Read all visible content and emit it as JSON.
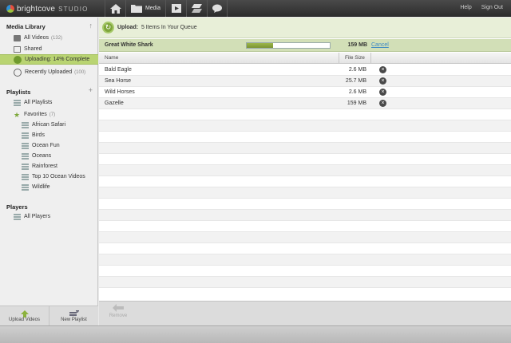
{
  "brand": {
    "name": "brightcove",
    "product": "STUDIO"
  },
  "topnav": {
    "media_label": "Media",
    "help": "Help",
    "sign_out": "Sign Out"
  },
  "sidebar": {
    "media_library": {
      "title": "Media Library",
      "items": [
        {
          "label": "All Videos",
          "count": "(132)"
        },
        {
          "label": "Shared",
          "count": ""
        },
        {
          "label": "Uploading:  14% Complete",
          "count": ""
        },
        {
          "label": "Recently Uploaded",
          "count": "(100)"
        }
      ]
    },
    "playlists": {
      "title": "Playlists",
      "all_label": "All Playlists",
      "favorites": {
        "label": "Favorites",
        "count": "(7)"
      },
      "items": [
        "African Safari",
        "Birds",
        "Ocean Fun",
        "Oceans",
        "Rainforest",
        "Top 10 Ocean Videos",
        "Wildlife"
      ]
    },
    "players": {
      "title": "Players",
      "all_label": "All Players"
    },
    "buttons": {
      "upload": "Upload Videos",
      "new_playlist": "New Playlist"
    }
  },
  "queue": {
    "prefix": "Upload:",
    "text": "5 Items In Your Queue",
    "current": {
      "name": "Great White Shark",
      "size": "159 MB",
      "progress": 0.32,
      "cancel": "Cancel"
    }
  },
  "table": {
    "headers": {
      "name": "Name",
      "size": "File Size"
    },
    "rows": [
      {
        "name": "Bald Eagle",
        "size": "2.6 MB"
      },
      {
        "name": "Sea Horse",
        "size": "25.7 MB"
      },
      {
        "name": "Wild Horses",
        "size": "2.6 MB"
      },
      {
        "name": "Gazelle",
        "size": "159 MB"
      }
    ]
  },
  "bottom": {
    "remove": "Remove"
  },
  "colors": {
    "accent_green": "#b9d472",
    "link_blue": "#3f8ac4",
    "topbar": "#3a3a3a"
  }
}
